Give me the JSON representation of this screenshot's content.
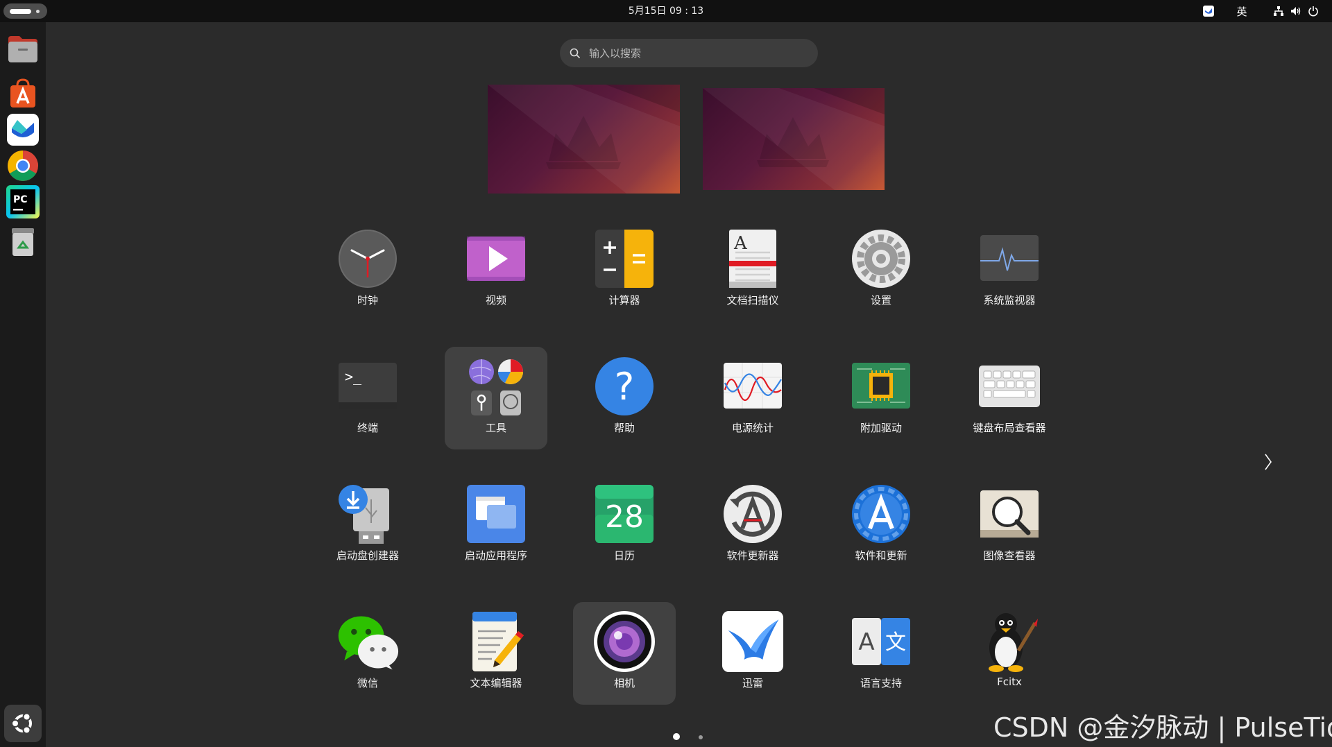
{
  "topbar": {
    "datetime": "5月15日  09 : 13",
    "input_method": "英"
  },
  "search": {
    "placeholder": "输入以搜索"
  },
  "apps": [
    {
      "label": "时钟"
    },
    {
      "label": "视频"
    },
    {
      "label": "计算器"
    },
    {
      "label": "文档扫描仪"
    },
    {
      "label": "设置"
    },
    {
      "label": "系统监视器"
    },
    {
      "label": "终端"
    },
    {
      "label": "工具"
    },
    {
      "label": "帮助"
    },
    {
      "label": "电源统计"
    },
    {
      "label": "附加驱动"
    },
    {
      "label": "键盘布局查看器"
    },
    {
      "label": "启动盘创建器"
    },
    {
      "label": "启动应用程序"
    },
    {
      "label": "日历"
    },
    {
      "label": "软件更新器"
    },
    {
      "label": "软件和更新"
    },
    {
      "label": "图像查看器"
    },
    {
      "label": "微信"
    },
    {
      "label": "文本编辑器"
    },
    {
      "label": "相机"
    },
    {
      "label": "迅雷"
    },
    {
      "label": "语言支持"
    },
    {
      "label": "Fcitx"
    }
  ],
  "icons": {
    "calendar_day": "28",
    "terminal_prompt": ">_",
    "help_glyph": "?",
    "scanner_glyph": "A",
    "language_left": "A",
    "language_right": "文",
    "pycharm_text": "PC"
  },
  "pagination": {
    "pages": 2,
    "current": 1
  },
  "watermark": "CSDN @金汐脉动 | PulseTide",
  "colors": {
    "panel": "#111111",
    "dock": "#1b1b1b",
    "background": "#2b2b2b",
    "highlight": "#414141"
  }
}
